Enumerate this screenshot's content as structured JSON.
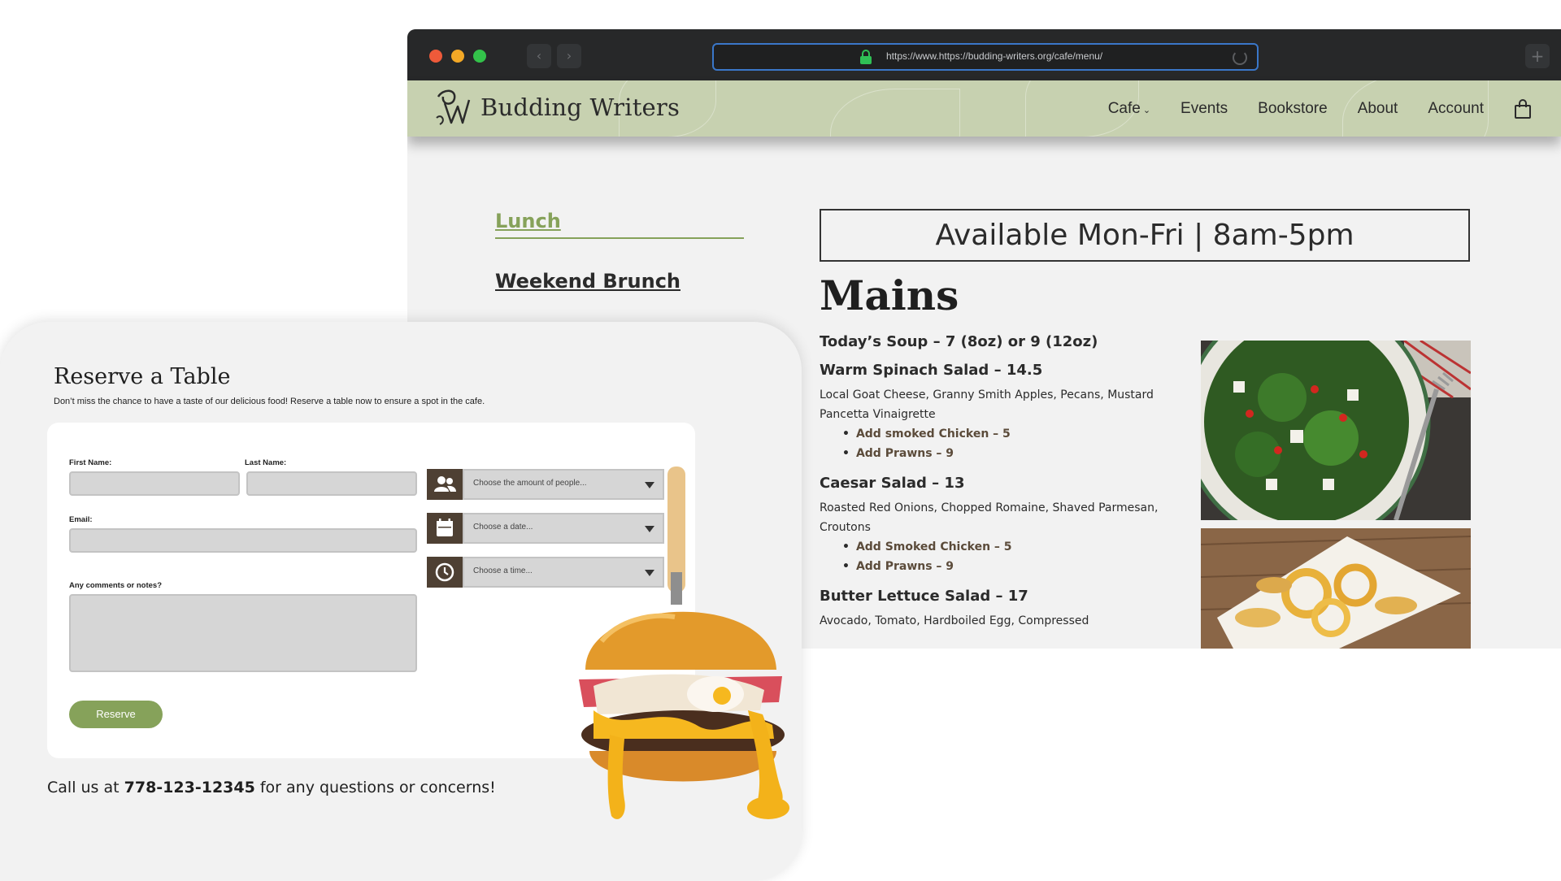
{
  "browser": {
    "url": "https://www.https://budding-writers.org/cafe/menu/"
  },
  "site": {
    "brand": "Budding Writers",
    "nav": [
      {
        "label": "Cafe",
        "has_dropdown": true
      },
      {
        "label": "Events"
      },
      {
        "label": "Bookstore"
      },
      {
        "label": "About"
      },
      {
        "label": "Account"
      }
    ],
    "cart_icon": "shopping-bag-icon"
  },
  "menu": {
    "tabs": [
      {
        "label": "Lunch",
        "active": true
      },
      {
        "label": "Weekend Brunch",
        "active": false
      }
    ],
    "availability": "Available Mon-Fri | 8am-5pm",
    "section_title": "Mains",
    "items": [
      {
        "title": "Today’s Soup – 7 (8oz) or 9 (12oz)",
        "desc": "",
        "addons": []
      },
      {
        "title": "Warm Spinach Salad – 14.5",
        "desc": "Local Goat Cheese, Granny Smith Apples, Pecans, Mustard Pancetta Vinaigrette",
        "addons": [
          "Add smoked Chicken – 5",
          "Add Prawns – 9"
        ]
      },
      {
        "title": "Caesar Salad – 13",
        "desc": "Roasted Red Onions, Chopped Romaine, Shaved Parmesan, Croutons",
        "addons": [
          "Add Smoked Chicken – 5",
          "Add Prawns – 9"
        ]
      },
      {
        "title": "Butter Lettuce Salad – 17",
        "desc": "Avocado, Tomato, Hardboiled Egg, Compressed",
        "addons": []
      }
    ]
  },
  "reserve": {
    "title": "Reserve a Table",
    "subtitle": "Don’t miss the chance to have a taste of our delicious food! Reserve a table now to ensure a spot in the cafe.",
    "first_name_label": "First Name:",
    "last_name_label": "Last Name:",
    "email_label": "Email:",
    "comments_label": "Any comments or notes?",
    "people_placeholder": "Choose the amount of people...",
    "date_placeholder": "Choose a date...",
    "time_placeholder": "Choose a time...",
    "button_label": "Reserve",
    "call_prefix": "Call us at ",
    "phone": "778-123-12345",
    "call_suffix": " for any questions or concerns!"
  },
  "colors": {
    "accent_green": "#86a25a",
    "header_green": "#c7d1b0",
    "icon_brown": "#4e4033"
  }
}
